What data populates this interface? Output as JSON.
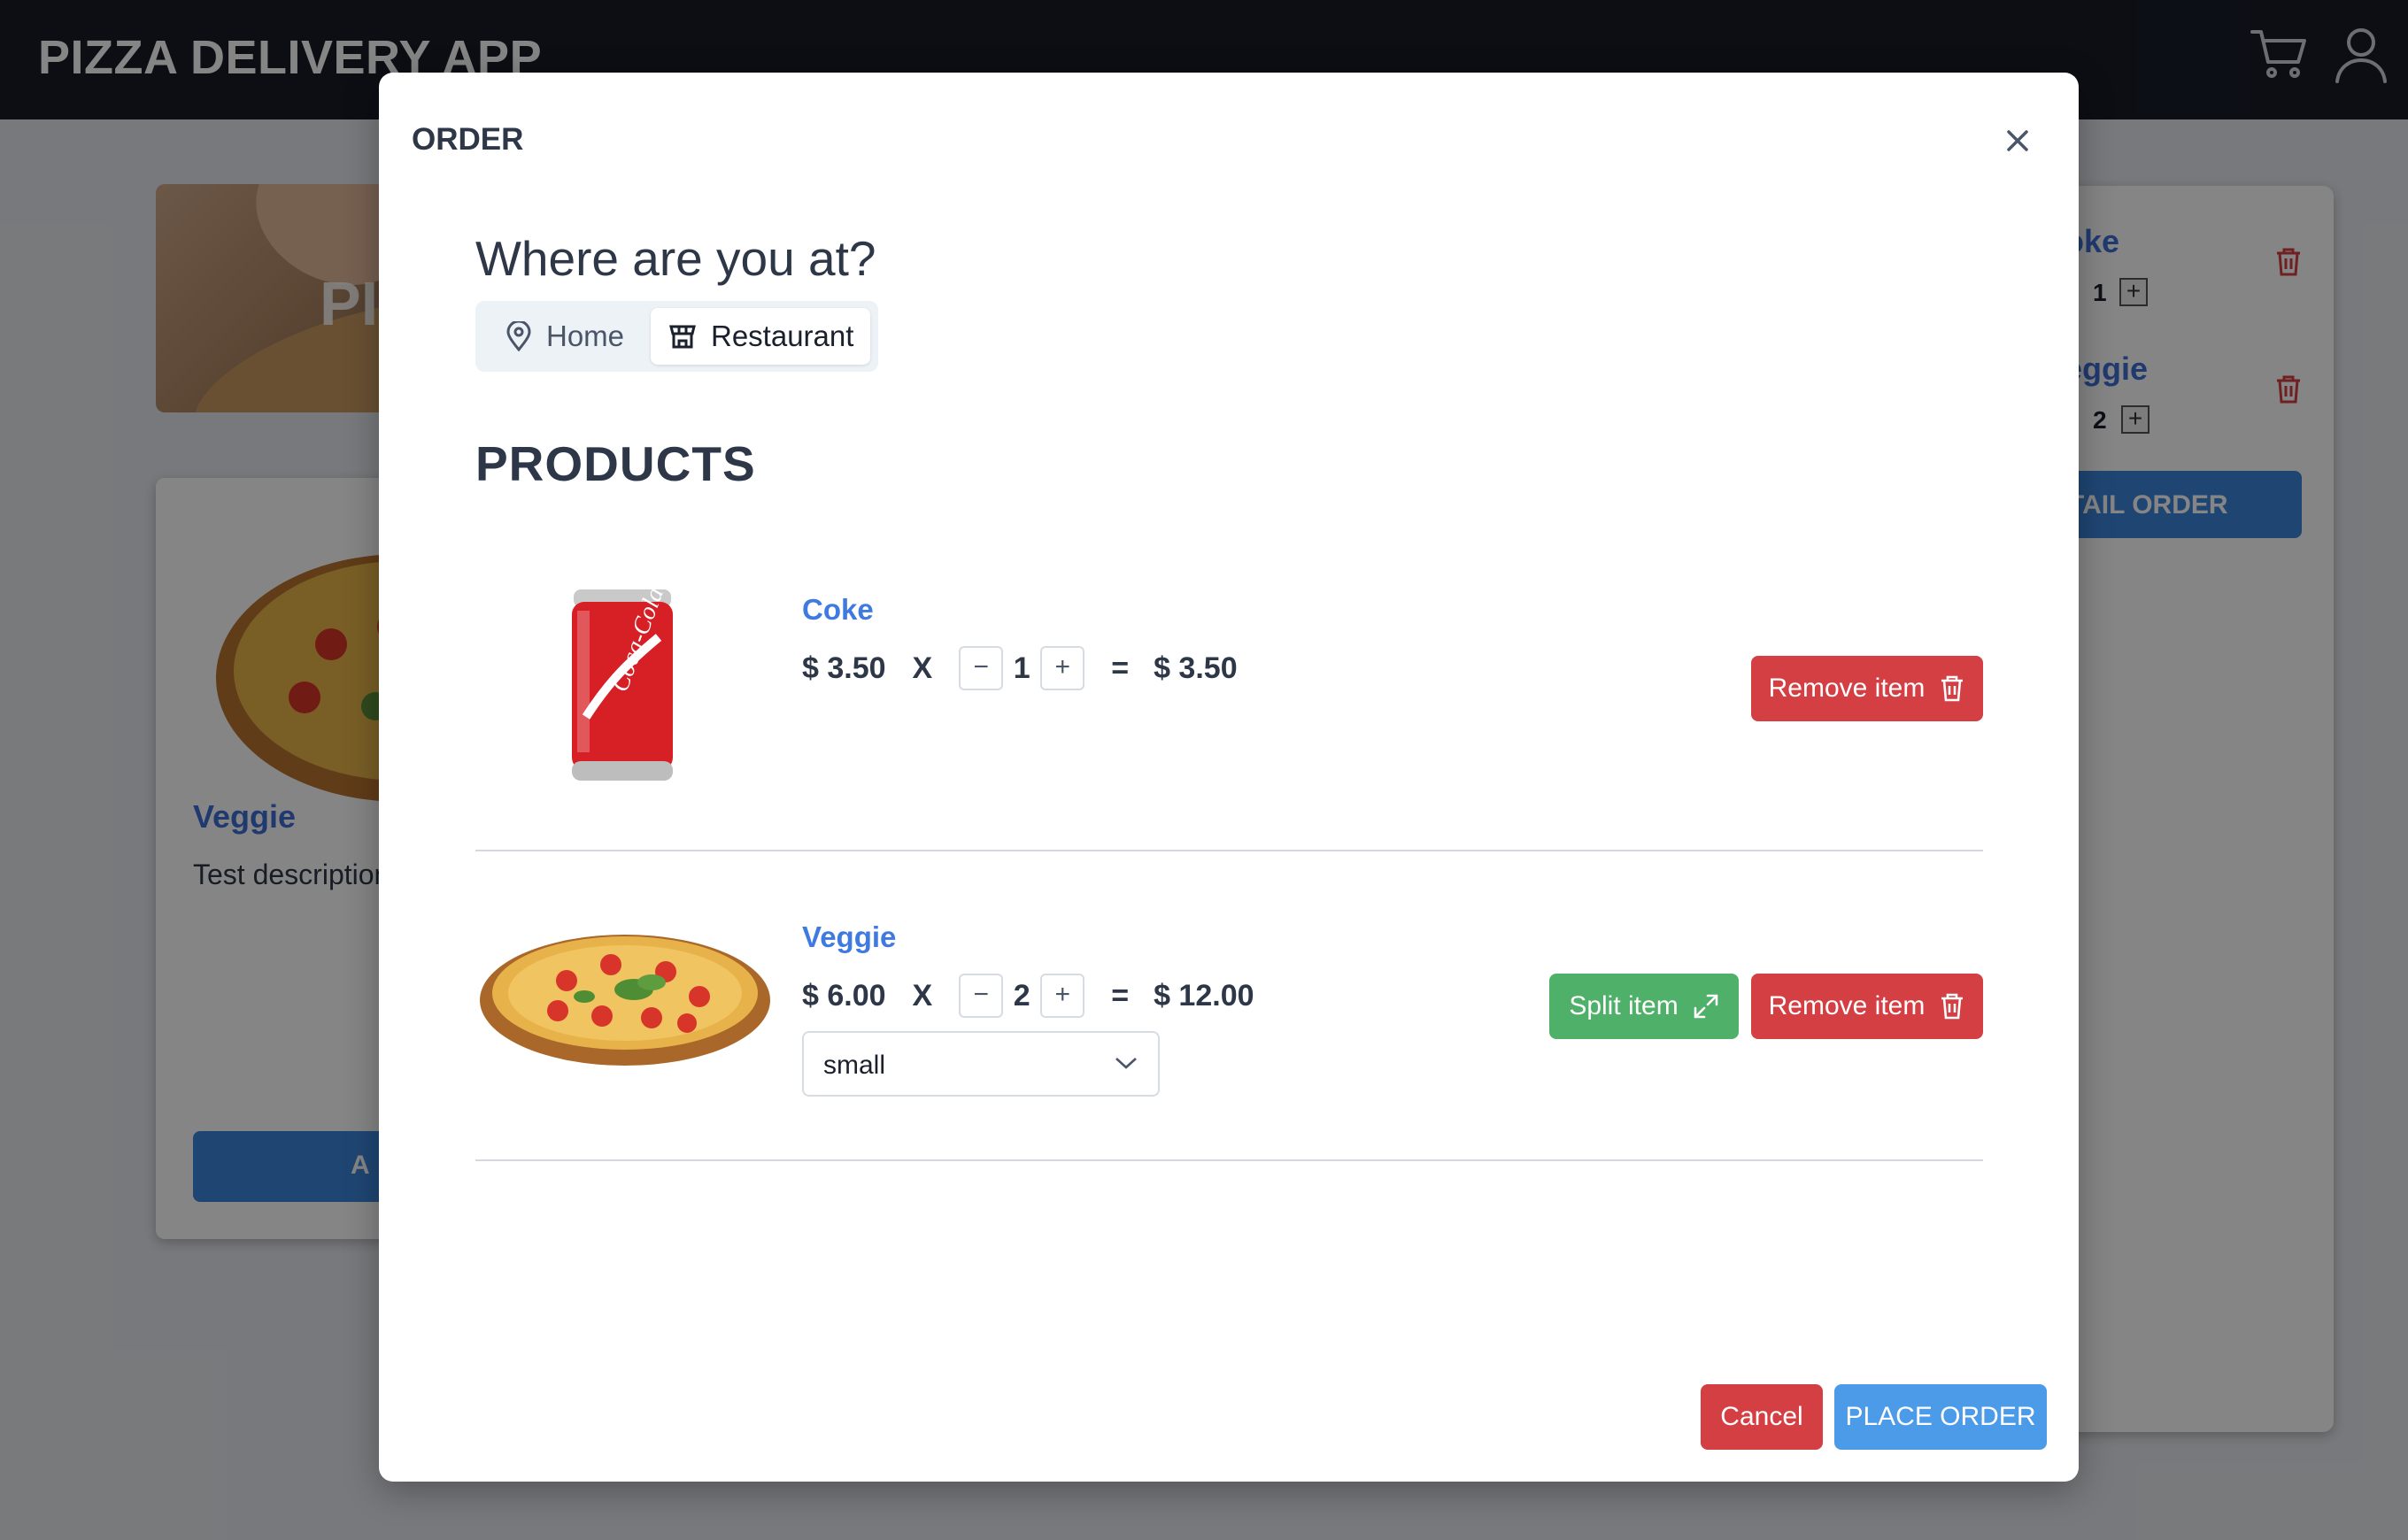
{
  "app": {
    "title": "PIZZA DELIVERY APP"
  },
  "header_icons": [
    "cart-icon",
    "user-icon"
  ],
  "background": {
    "banner_text": "PIZ",
    "product_card": {
      "title": "Veggie",
      "description": "Test description",
      "button_label": "A"
    },
    "side_cart": {
      "items": [
        {
          "name": "oke",
          "qty": "1"
        },
        {
          "name": "eggie",
          "qty": "2"
        }
      ],
      "button_label": "TAIL ORDER"
    }
  },
  "modal": {
    "title": "ORDER",
    "location": {
      "question": "Where are you at?",
      "options": [
        "Home",
        "Restaurant"
      ],
      "selected": "Restaurant"
    },
    "products_heading": "PRODUCTS",
    "items": [
      {
        "name": "Coke",
        "unit_price": "$ 3.50",
        "times": "X",
        "minus": "−",
        "quantity": "1",
        "plus": "+",
        "equals": "=",
        "total": "$ 3.50",
        "remove_label": "Remove item"
      },
      {
        "name": "Veggie",
        "unit_price": "$ 6.00",
        "times": "X",
        "minus": "−",
        "quantity": "2",
        "plus": "+",
        "equals": "=",
        "total": "$ 12.00",
        "size": "small",
        "split_label": "Split item",
        "remove_label": "Remove item"
      }
    ],
    "cancel_label": "Cancel",
    "place_order_label": "PLACE ORDER"
  },
  "colors": {
    "topbar": "#171c28",
    "accent_blue": "#3f7ae0",
    "danger": "#d43f44",
    "success": "#4fb06a",
    "primary": "#4b9be8"
  }
}
